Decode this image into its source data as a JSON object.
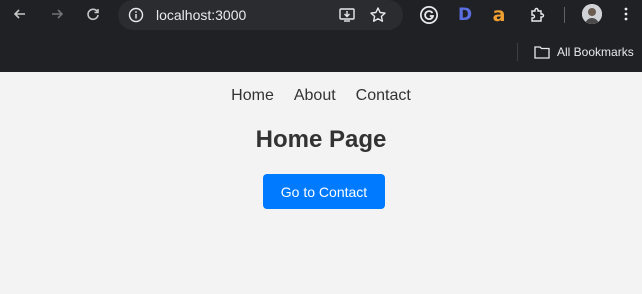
{
  "browser": {
    "url": "localhost:3000",
    "icons": [
      "back-icon",
      "forward-icon",
      "reload-icon",
      "site-info-icon",
      "install-app-icon",
      "bookmark-star-icon",
      "grammarly-icon",
      "d-extension-icon",
      "amazon-extension-icon",
      "extensions-puzzle-icon",
      "profile-avatar",
      "menu-kebab-icon"
    ],
    "extension_d_letter": "D",
    "extension_a_letter": "a"
  },
  "bookmarks_bar": {
    "all_bookmarks_label": "All Bookmarks"
  },
  "app": {
    "nav": [
      {
        "label": "Home"
      },
      {
        "label": "About"
      },
      {
        "label": "Contact"
      }
    ],
    "title": "Home Page",
    "cta_label": "Go to Contact",
    "accent_color": "#007bff"
  }
}
